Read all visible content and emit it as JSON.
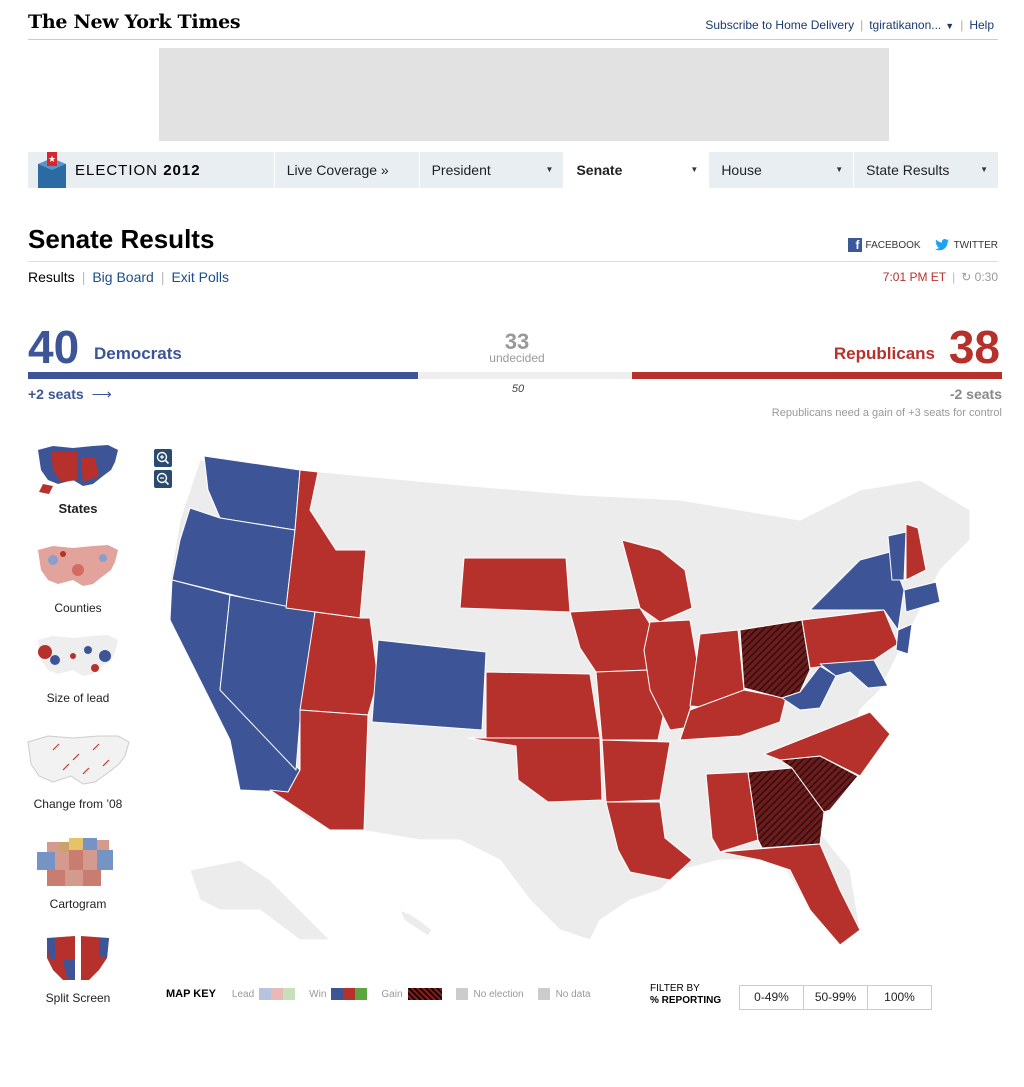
{
  "masthead": {
    "logo": "The New York Times",
    "subscribe": "Subscribe to Home Delivery",
    "user": "tgiratikanon...",
    "help": "Help"
  },
  "election_nav": {
    "brand_prefix": "ELECTION",
    "brand_year": "2012",
    "tabs": [
      {
        "label": "Live Coverage »",
        "dropdown": false,
        "active": false
      },
      {
        "label": "President",
        "dropdown": true,
        "active": false
      },
      {
        "label": "Senate",
        "dropdown": true,
        "active": true
      },
      {
        "label": "House",
        "dropdown": true,
        "active": false
      },
      {
        "label": "State Results",
        "dropdown": true,
        "active": false
      }
    ]
  },
  "page": {
    "title": "Senate Results",
    "facebook": "FACEBOOK",
    "twitter": "TWITTER",
    "subnav": [
      "Results",
      "Big Board",
      "Exit Polls"
    ],
    "time": "7:01 PM ET",
    "refresh": "0:30"
  },
  "tally": {
    "dem_seats": "40",
    "dem_label": "Democrats",
    "dem_change": "+2 seats",
    "undecided_count": "33",
    "undecided_label": "undecided",
    "majority_mark": "50",
    "rep_seats": "38",
    "rep_label": "Republicans",
    "rep_change": "-2 seats",
    "control_note": "Republicans need a gain of +3 seats for control",
    "total_seats": 100
  },
  "views": [
    "States",
    "Counties",
    "Size of lead",
    "Change from ’08",
    "Cartogram",
    "Split Screen"
  ],
  "map_key": {
    "title": "MAP KEY",
    "lead": "Lead",
    "win": "Win",
    "gain": "Gain",
    "no_election": "No election",
    "no_data": "No data"
  },
  "filter": {
    "title_line1": "FILTER BY",
    "title_line2": "% REPORTING",
    "options": [
      "0-49%",
      "50-99%",
      "100%"
    ]
  },
  "colors": {
    "democrat": "#3d5597",
    "republican": "#b7312c",
    "no_election": "#ececec",
    "gain_dark": "#5a1a1a"
  }
}
